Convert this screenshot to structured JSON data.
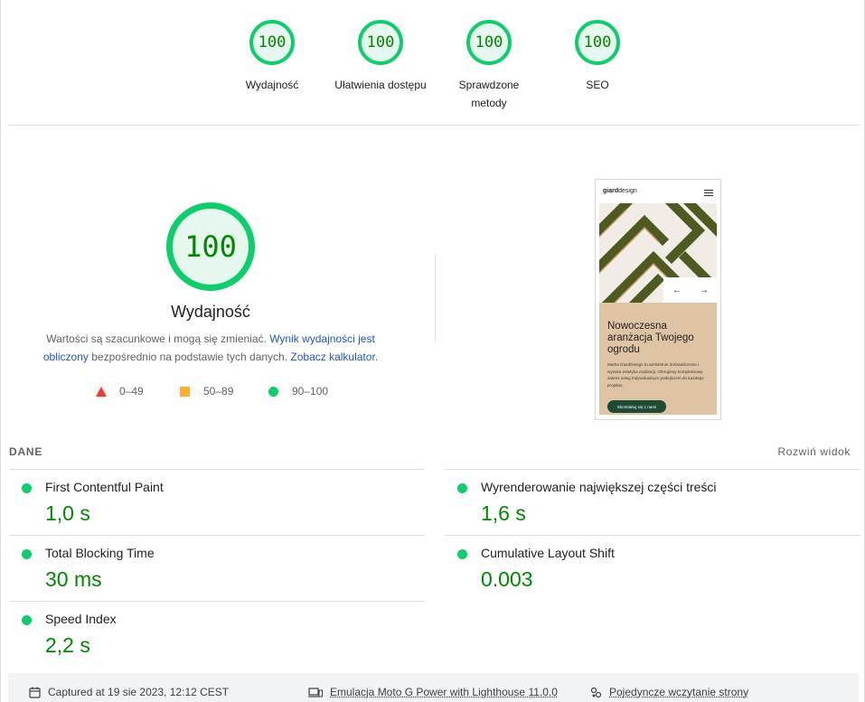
{
  "gauges": [
    {
      "score": "100",
      "label": "Wydajność"
    },
    {
      "score": "100",
      "label": "Ułatwienia dostępu"
    },
    {
      "score": "100",
      "label": "Sprawdzone metody"
    },
    {
      "score": "100",
      "label": "SEO"
    }
  ],
  "performance": {
    "score": "100",
    "title": "Wydajność",
    "desc_part1": "Wartości są szacunkowe i mogą się zmieniać. ",
    "desc_link1": "Wynik wydajności jest obliczony",
    "desc_part2": " bezpośrednio na podstawie tych danych. ",
    "desc_link2": "Zobacz kalkulator",
    "desc_part3": "."
  },
  "legend": {
    "fail": "0–49",
    "average": "50–89",
    "pass": "90–100"
  },
  "screenshot": {
    "brand_bold": "giard",
    "brand_rest": "design",
    "prev": "←",
    "next": "→",
    "heading": "Nowoczesna aranżacja Twojego ogrodu",
    "text": "Marka GiardDesign to wieloletnie doświadczenie i wysoka estetyka realizacji. Oferujemy kompleksowy zakres usług indywidualnym podejściem do każdego projektu.",
    "button": "Skontaktuj się z nami"
  },
  "metrics_section": {
    "label": "DANE",
    "expand": "Rozwiń widok"
  },
  "metrics": [
    {
      "name": "First Contentful Paint",
      "value": "1,0 s"
    },
    {
      "name": "Wyrenderowanie największej części treści",
      "value": "1,6 s"
    },
    {
      "name": "Total Blocking Time",
      "value": "30 ms"
    },
    {
      "name": "Cumulative Layout Shift",
      "value": "0.003"
    },
    {
      "name": "Speed Index",
      "value": "2,2 s"
    }
  ],
  "footer": {
    "captured": "Captured at 19 sie 2023, 12:12 CEST",
    "emulation": "Emulacja Moto G Power with Lighthouse 11.0.0",
    "load": "Pojedyncze wczytanie strony"
  },
  "colors": {
    "pass": "#0cce6b",
    "pass_text": "#008800",
    "average": "#ffaa33",
    "fail": "#ff3333",
    "link": "#1a56db"
  }
}
